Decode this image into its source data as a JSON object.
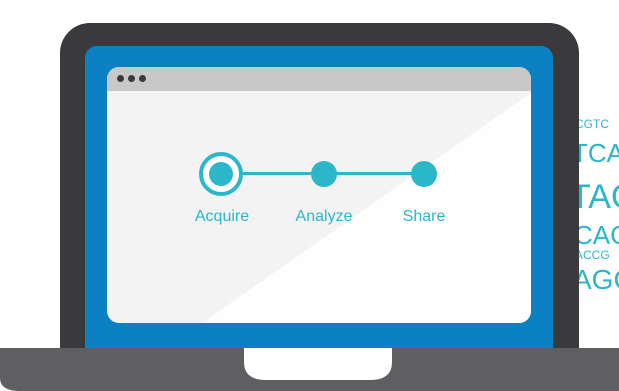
{
  "workflow": {
    "steps": [
      {
        "label": "Acquire",
        "state": "current"
      },
      {
        "label": "Analyze",
        "state": "upcoming"
      },
      {
        "label": "Share",
        "state": "upcoming"
      }
    ],
    "accent_color": "#2bb7c9"
  },
  "sequence_text": {
    "lines": [
      "CGTC",
      "TCA",
      "TAC",
      "CAC",
      "ACCG",
      "AGC"
    ]
  },
  "colors": {
    "laptop_body": "#3a3a3c",
    "screen_blue": "#0b80c3",
    "browser_bg": "#f3f3f3",
    "browser_bar": "#c8c8c8",
    "base": "#5f5f61"
  },
  "icons": {
    "window_controls": "three-dots-icon",
    "current_step": "ring-dot-icon",
    "upcoming_step": "filled-dot-icon"
  }
}
